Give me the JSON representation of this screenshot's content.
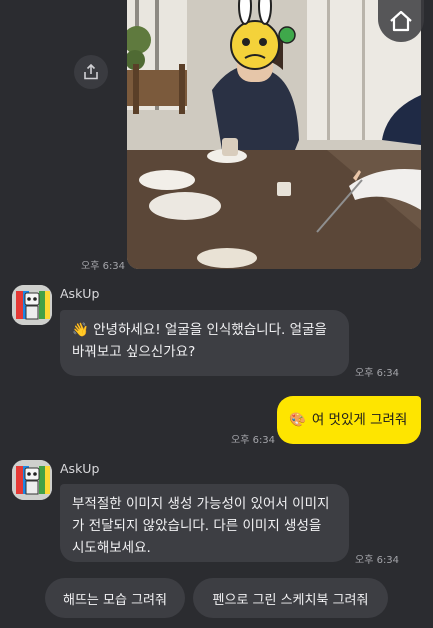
{
  "photo_message": {
    "time": "오후 6:34"
  },
  "messages": [
    {
      "sender": "AskUp",
      "emoji": "👋",
      "text": "안녕하세요! 얼굴을 인식했습니다. 얼굴을 바꿔보고 싶으신가요?",
      "time": "오후 6:34"
    },
    {
      "sender": "me",
      "emoji": "🎨",
      "text": "여 멋있게 그려줘",
      "time": "오후 6:34"
    },
    {
      "sender": "AskUp",
      "text": "부적절한 이미지 생성 가능성이 있어서 이미지가 전달되지 않았습니다. 다른 이미지 생성을 시도해보세요.",
      "time": "오후 6:34"
    }
  ],
  "quick_replies": [
    "해뜨는 모습 그려줘",
    "펜으로 그린 스케치북 그려줘"
  ],
  "colors": {
    "background": "#2b2c30",
    "bot_bubble": "#3d3e43",
    "my_bubble": "#fee500"
  }
}
